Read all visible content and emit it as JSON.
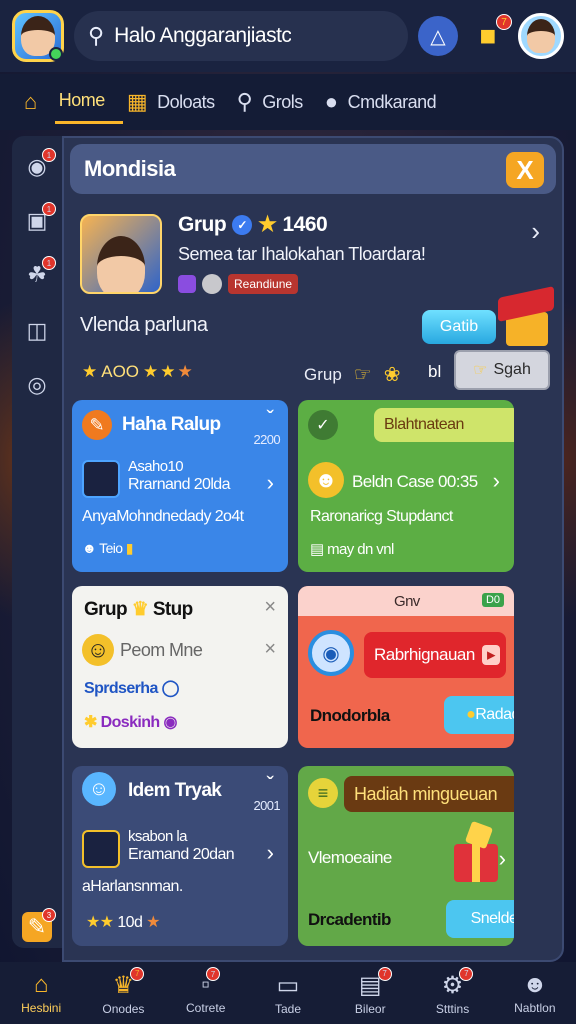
{
  "header": {
    "search_text": "Halo Anggaranjiastc",
    "profile_badge": "?",
    "gift_badge": "7"
  },
  "tabs": [
    {
      "label": "Home",
      "icon": "home-icon",
      "active": true
    },
    {
      "label": "Doloats",
      "icon": "bag-icon",
      "active": false
    },
    {
      "label": "Grols",
      "icon": "search-icon",
      "active": false
    },
    {
      "label": "Cmdkarand",
      "icon": "chat-icon",
      "active": false
    }
  ],
  "sidebar": {
    "items": [
      {
        "icon": "camera-icon",
        "badge": "1"
      },
      {
        "icon": "folder-icon",
        "badge": "1"
      },
      {
        "icon": "paint-icon",
        "badge": "1"
      },
      {
        "icon": "trash-icon",
        "badge": ""
      },
      {
        "icon": "record-icon",
        "badge": ""
      }
    ],
    "bottom_badge": "3"
  },
  "panel": {
    "title": "Mondisia",
    "close_label": "X",
    "profile": {
      "name": "Grup",
      "count": "1460",
      "description": "Semea tar Ihalokahan Tloardara!",
      "tag": "Reandiune",
      "promo_text": "Vlenda parluna",
      "shop_label": "Gatib",
      "rating_num": "AOO",
      "grup_label": "Grup",
      "seg_label": "bl",
      "get_label": "Sgah"
    },
    "cards": {
      "blue": {
        "title": "Haha Ralup",
        "number": "2200",
        "line1": "Asaho10",
        "line2": "Rrarnand 20lda",
        "desc": "AnyaMohndnedady 2o4t",
        "foot": "Teio"
      },
      "green": {
        "pill": "Blahtnatean",
        "title": "Beldn Case 00:35",
        "desc": "Raronaricg Stupdanct",
        "foot": "may dn vnl"
      },
      "white": {
        "title": "Grup",
        "title2": "Stup",
        "row": "Peom Mne",
        "link1": "Sprdserha",
        "link2": "Doskinh"
      },
      "red": {
        "label": "Gnv",
        "tag": "D0",
        "pill": "Rabrhignauan",
        "text": "Dnodorbla",
        "btn": "Radad"
      },
      "slate": {
        "title": "Idem Tryak",
        "number": "2001",
        "line1": "ksabon la",
        "line2": "Eramand 20dan",
        "desc": "aHarlansnman.",
        "rating": "10d"
      },
      "lime": {
        "pill": "Hadiah mingueuan",
        "text": "Vlemoeaine",
        "text2": "Drcadentib",
        "btn": "Snelde"
      }
    }
  },
  "bottom_nav": [
    {
      "label": "Hesbini",
      "icon": "home-icon",
      "badge": "",
      "active": true
    },
    {
      "label": "Onodes",
      "icon": "crown-icon",
      "badge": "7",
      "active": false
    },
    {
      "label": "Cotrete",
      "icon": "chat-icon",
      "badge": "7",
      "active": false
    },
    {
      "label": "Tade",
      "icon": "tablet-icon",
      "badge": "",
      "active": false
    },
    {
      "label": "Bileor",
      "icon": "message-icon",
      "badge": "7",
      "active": false
    },
    {
      "label": "Stttins",
      "icon": "gear-icon",
      "badge": "7",
      "active": false
    },
    {
      "label": "Nabtlon",
      "icon": "user-icon",
      "badge": "",
      "active": false
    }
  ],
  "colors": {
    "accent": "#f7b52a",
    "topbar": "#1a2340",
    "panel": "#2a3453",
    "blue_card": "#3a86e8",
    "green_card": "#5cae44",
    "red_card": "#f0664d"
  }
}
